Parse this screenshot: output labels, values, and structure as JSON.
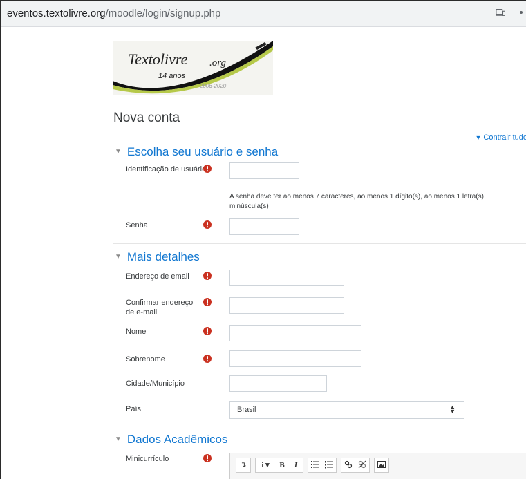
{
  "browser": {
    "url_host": "eventos.textolivre.org",
    "url_path": "/moodle/login/signup.php"
  },
  "logo": {
    "name": "Textolivre",
    "domain": ".org",
    "years": "14 anos",
    "range": "2006-2020"
  },
  "page": {
    "title": "Nova conta",
    "collapse_all": "Contrair tudo"
  },
  "sections": {
    "account": {
      "title": "Escolha seu usuário e senha",
      "username_label": "Identificação de usuário",
      "password_help": "A senha deve ter ao menos 7 caracteres, ao menos 1 dígito(s), ao menos 1 letra(s) minúscula(s)",
      "password_label": "Senha"
    },
    "details": {
      "title": "Mais detalhes",
      "email_label": "Endereço de email",
      "email_confirm_label": "Confirmar endereço de e-mail",
      "firstname_label": "Nome",
      "lastname_label": "Sobrenome",
      "city_label": "Cidade/Município",
      "country_label": "País",
      "country_value": "Brasil"
    },
    "academic": {
      "title": "Dados Acadêmicos",
      "bio_label": "Minicurrículo"
    }
  },
  "colors": {
    "link": "#1177d1",
    "required": "#ca3120"
  }
}
